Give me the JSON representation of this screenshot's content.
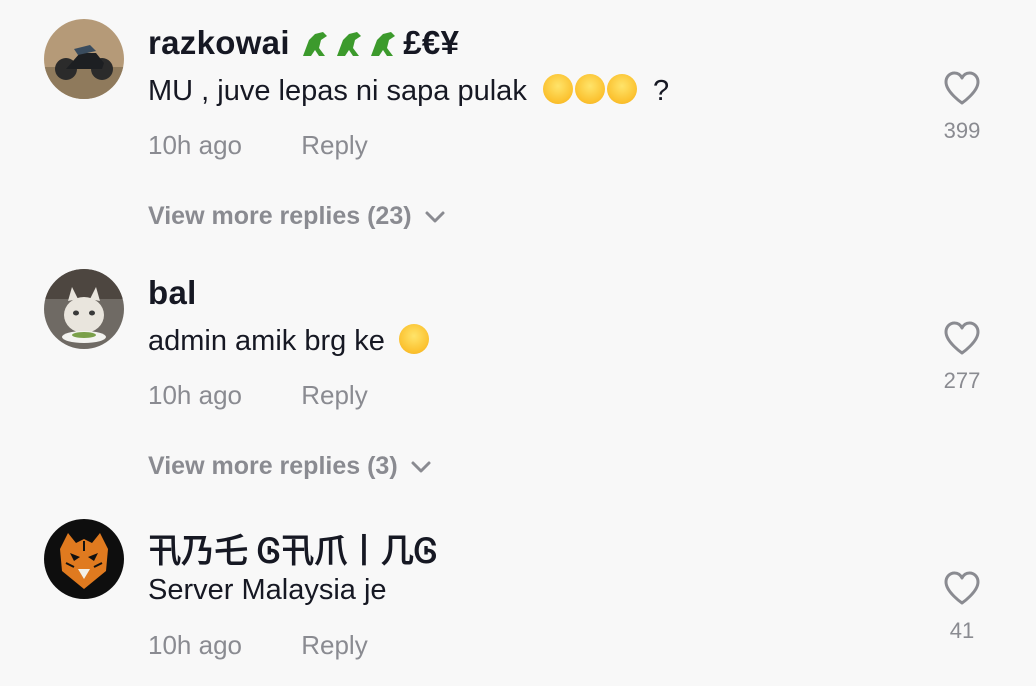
{
  "comments": [
    {
      "username": "razkowai",
      "username_suffix": "£€¥",
      "text": "MU , juve lepas ni sapa pulak",
      "text_suffix": "?",
      "emoji": "😅😅😅",
      "time": "10h ago",
      "reply_label": "Reply",
      "likes": "399",
      "view_more": "View more replies (23)"
    },
    {
      "username": "bal",
      "text": "admin amik brg ke",
      "emoji": "😂",
      "time": "10h ago",
      "reply_label": "Reply",
      "likes": "277",
      "view_more": "View more replies (3)"
    },
    {
      "username": "卂乃乇 Ꮆ卂爪丨几Ꮆ",
      "text": "Server Malaysia je",
      "time": "10h ago",
      "reply_label": "Reply",
      "likes": "41"
    }
  ],
  "colors": {
    "background": "#f8f8f8",
    "primary_text": "#161823",
    "secondary_text": "#8a8b91"
  },
  "icons": [
    "heart-outline-icon",
    "chevron-down-icon",
    "dinosaur-emoji",
    "sweat-smile-emoji",
    "tears-of-joy-emoji"
  ]
}
